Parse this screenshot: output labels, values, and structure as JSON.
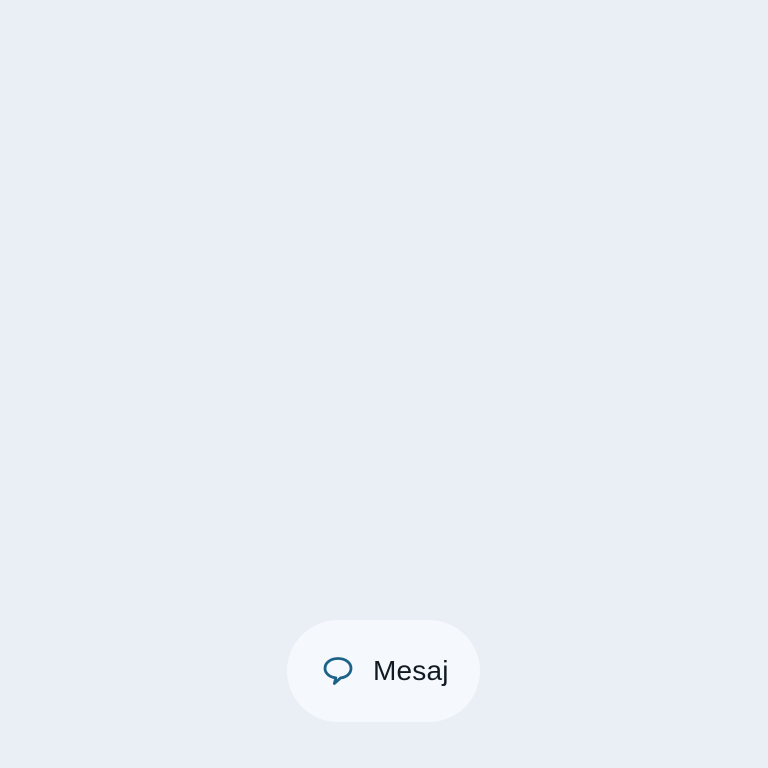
{
  "background_color": "#eaeef5",
  "message_button": {
    "label": "Mesaj",
    "icon": "speech-bubble-icon",
    "icon_color": "#1d6388",
    "background_color": "#f5f8fd"
  }
}
